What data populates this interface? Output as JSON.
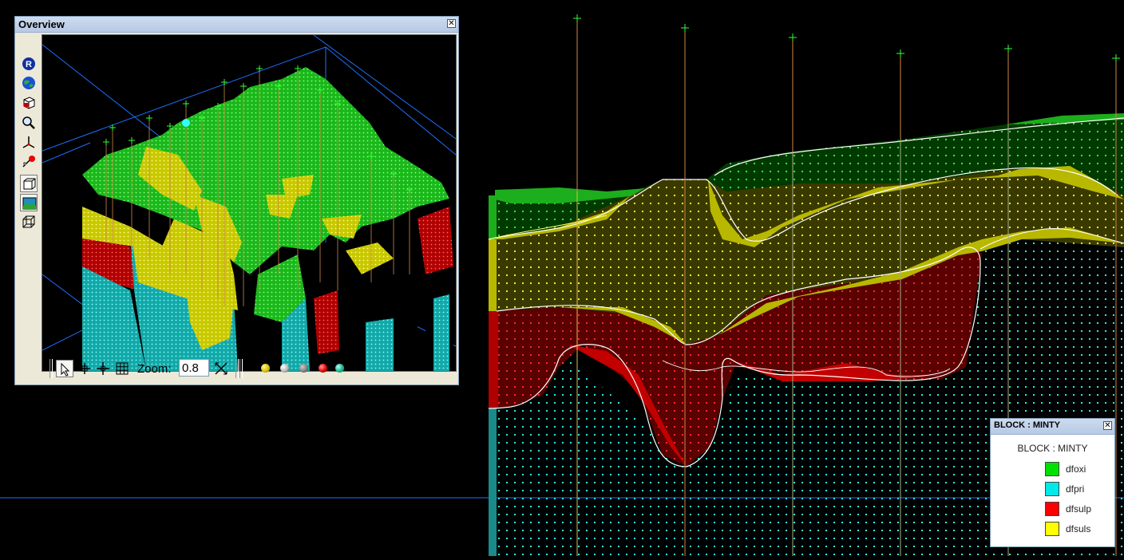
{
  "overview": {
    "title": "Overview",
    "close_glyph": "x",
    "toolbar_icons": [
      "render-icon",
      "globe-icon",
      "cube-icon",
      "magnify-icon",
      "axes-icon",
      "light-icon",
      "box-frame-icon",
      "image-icon",
      "wire-cube-icon"
    ],
    "bottom_icons": [
      "pointer-icon",
      "pan-cross-icon",
      "rotate-cross-icon",
      "grid-icon"
    ],
    "zoom_label": "Zoom:",
    "zoom_value": "0.8",
    "ball_colors": [
      "#d6c100",
      "#b8b8b8",
      "#808080",
      "#e00000",
      "#18b090"
    ]
  },
  "legend": {
    "title": "BLOCK : MINTY",
    "subtitle": "BLOCK : MINTY",
    "items": [
      {
        "label": "dfoxi",
        "color": "#00e000"
      },
      {
        "label": "dfpri",
        "color": "#00e8e8"
      },
      {
        "label": "dfsulp",
        "color": "#ff0000"
      },
      {
        "label": "dfsuls",
        "color": "#ffff00"
      }
    ]
  },
  "colors": {
    "dfoxi": "#1ed41e",
    "dfpri": "#1fc8c8",
    "dfsulp": "#cc0000",
    "dfsuls": "#e6e600",
    "guide": "#1e6fff",
    "drillhole": "#cc8844",
    "collar": "#33ff33"
  }
}
